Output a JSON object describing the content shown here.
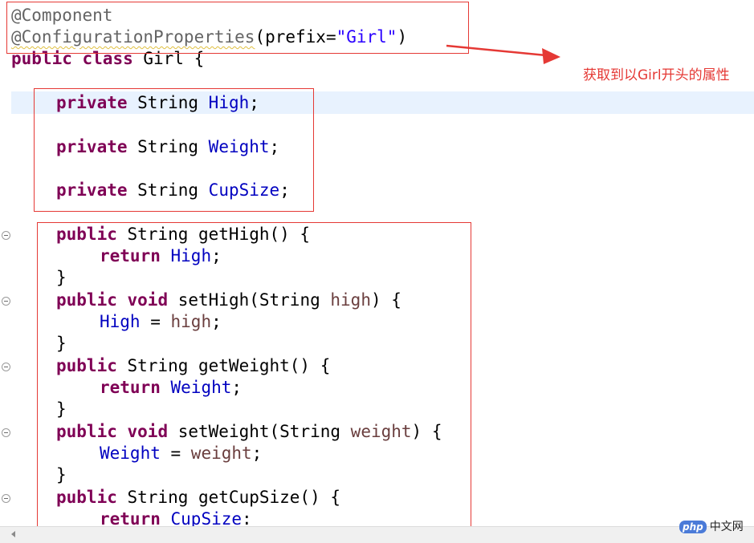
{
  "code": {
    "l1": "@Component",
    "l2_ann": "@ConfigurationProperties",
    "l2_open": "(prefix=",
    "l2_str": "\"Girl\"",
    "l2_close": ")",
    "l3_kw1": "public",
    "l3_kw2": "class",
    "l3_rest": " Girl {",
    "f1_kw": "private",
    "f1_type": " String ",
    "f1_name": "High",
    "f1_end": ";",
    "f2_kw": "private",
    "f2_type": " String ",
    "f2_name": "Weight",
    "f2_end": ";",
    "f3_kw": "private",
    "f3_type": " String ",
    "f3_name": "CupSize",
    "f3_end": ";",
    "m1_kw": "public",
    "m1_rest": " String getHigh() {",
    "m1_ret": "return",
    "m1_field": "High",
    "m1_end": ";",
    "brace": "}",
    "m2_kw1": "public",
    "m2_kw2": "void",
    "m2_sig1": " setHigh(String ",
    "m2_param": "high",
    "m2_sig2": ") {",
    "m2_field": "High",
    "m2_eq": " = ",
    "m2_val": "high",
    "m2_end": ";",
    "m3_kw": "public",
    "m3_rest": " String getWeight() {",
    "m3_ret": "return",
    "m3_field": "Weight",
    "m3_end": ";",
    "m4_kw1": "public",
    "m4_kw2": "void",
    "m4_sig1": " setWeight(String ",
    "m4_param": "weight",
    "m4_sig2": ") {",
    "m4_field": "Weight",
    "m4_eq": " = ",
    "m4_val": "weight",
    "m4_end": ";",
    "m5_kw": "public",
    "m5_rest": " String getCupSize() {",
    "m5_ret": "return",
    "m5_field": "CupSize",
    "m5_end": ":"
  },
  "annotation_note": "获取到以Girl开头的属性",
  "watermark": {
    "badge": "php",
    "text": "中文网"
  },
  "colors": {
    "keyword": "#7f0055",
    "field": "#0000c0",
    "string": "#2a00ff",
    "annotation": "#646464",
    "parameter": "#6a3e3e",
    "highlight_box": "#e53935",
    "current_line": "#e8f2fe"
  }
}
